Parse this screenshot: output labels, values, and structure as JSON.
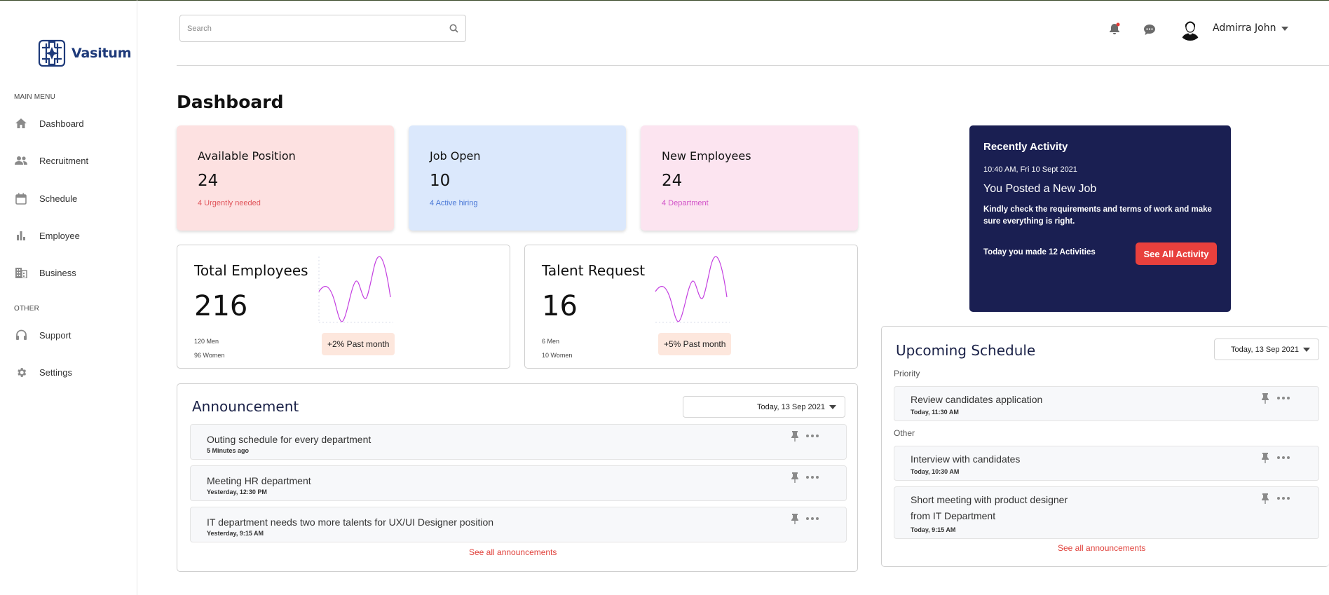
{
  "app": {
    "brand": "Vasitum",
    "brand_color": "#1e3a7a"
  },
  "sidebar": {
    "main_menu_label": "MAIN MENU",
    "other_label": "OTHER",
    "items": [
      {
        "label": "Dashboard",
        "icon": "home-icon"
      },
      {
        "label": "Recruitment",
        "icon": "people-icon"
      },
      {
        "label": "Schedule",
        "icon": "calendar-icon"
      },
      {
        "label": "Employee",
        "icon": "bar-chart-icon"
      },
      {
        "label": "Business",
        "icon": "building-icon"
      }
    ],
    "other_items": [
      {
        "label": "Support",
        "icon": "headset-icon"
      },
      {
        "label": "Settings",
        "icon": "gear-icon"
      }
    ]
  },
  "header": {
    "search_placeholder": "Search",
    "user_name": "Admirra John"
  },
  "page": {
    "title": "Dashboard"
  },
  "stats": [
    {
      "title": "Available Position",
      "value": "24",
      "note": "4 Urgently needed",
      "bg": "#fde1e1",
      "note_color": "#e0545a"
    },
    {
      "title": "Job Open",
      "value": "10",
      "note": "4 Active hiring",
      "bg": "#dbe8fc",
      "note_color": "#4a78d6"
    },
    {
      "title": "New Employees",
      "value": "24",
      "note": "4 Department",
      "bg": "#fce4f0",
      "note_color": "#d152c8"
    }
  ],
  "metrics": [
    {
      "title": "Total Employees",
      "value": "216",
      "sub1": "120 Men",
      "sub2": "96 Women",
      "change": "+2% Past month"
    },
    {
      "title": "Talent Request",
      "value": "16",
      "sub1": "6 Men",
      "sub2": "10 Women",
      "change": "+5% Past month"
    }
  ],
  "announcement": {
    "title": "Announcement",
    "date": "Today, 13 Sep 2021",
    "items": [
      {
        "title": "Outing schedule for every department",
        "time": "5 Minutes ago"
      },
      {
        "title": "Meeting HR department",
        "time": "Yesterday, 12:30 PM"
      },
      {
        "title": "IT department needs two more talents for UX/UI Designer position",
        "time": "Yesterday, 9:15 AM"
      }
    ],
    "see_all": "See all announcements"
  },
  "activity": {
    "title": "Recently Activity",
    "time": "10:40 AM, Fri 10 Sept 2021",
    "headline": "You Posted a New Job",
    "description": "Kindly check the requirements and terms of work and make sure everything is right.",
    "count_text": "Today you made 12 Activities",
    "button": "See All Activity"
  },
  "schedule": {
    "title": "Upcoming Schedule",
    "date": "Today, 13 Sep 2021",
    "priority_label": "Priority",
    "other_label": "Other",
    "priority_items": [
      {
        "title": "Review candidates application",
        "time": "Today, 11:30 AM"
      }
    ],
    "other_items": [
      {
        "title": "Interview with candidates",
        "time": "Today, 10:30 AM"
      },
      {
        "title_line1": "Short meeting with product designer",
        "title_line2": "from IT Department",
        "time": "Today, 9:15 AM"
      }
    ],
    "see_all": "See all announcements"
  }
}
